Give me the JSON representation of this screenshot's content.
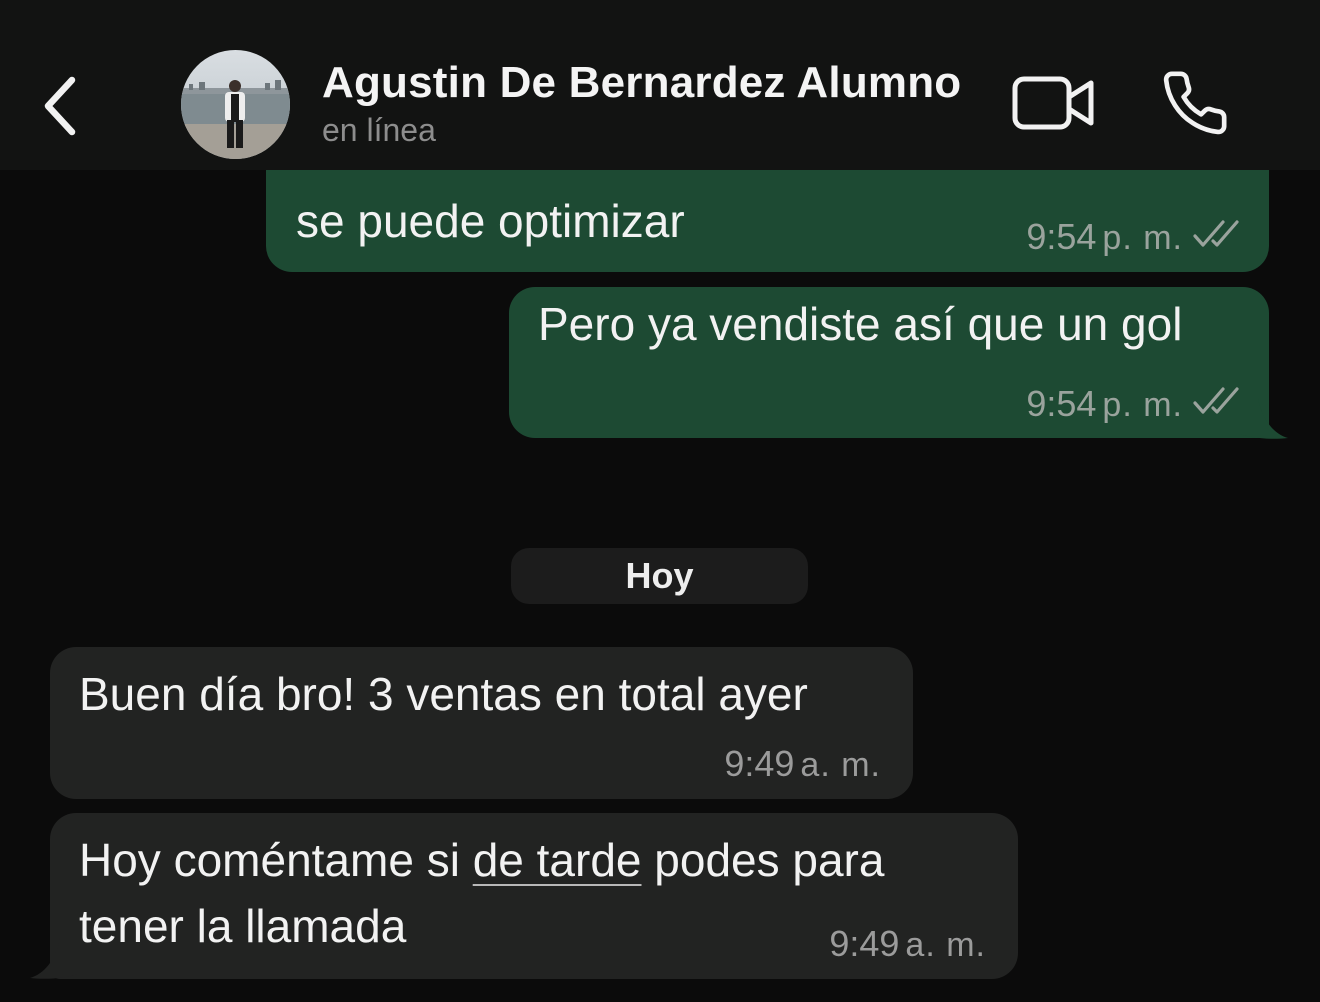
{
  "header": {
    "contact_name": "Agustin De Bernardez Alumno",
    "status": "en línea",
    "back_icon": "chevron-left-icon",
    "video_icon": "video-camera-icon",
    "call_icon": "phone-icon"
  },
  "colors": {
    "header_bg": "#121312",
    "chat_bg": "#0b0b0b",
    "outgoing_bubble": "#1d4a33",
    "incoming_bubble": "#222322",
    "read_ticks": "#9aa39d"
  },
  "messages": [
    {
      "direction": "out",
      "lines": [
        "se puede optimizar"
      ],
      "time": "9:54",
      "suffix": "p. m.",
      "status": "read"
    },
    {
      "direction": "out",
      "lines": [
        "Pero ya vendiste así que un gol"
      ],
      "time": "9:54",
      "suffix": "p. m.",
      "status": "read"
    },
    {
      "direction": "in",
      "lines": [
        "Buen día bro! 3 ventas en total ayer"
      ],
      "time": "9:49",
      "suffix": "a. m."
    },
    {
      "direction": "in",
      "line1_pre": "Hoy coméntame si ",
      "line1_link": "de tarde",
      "line1_post": " podes para",
      "line2": "tener la llamada",
      "time": "9:49",
      "suffix": "a. m."
    }
  ],
  "date_separator": "Hoy"
}
